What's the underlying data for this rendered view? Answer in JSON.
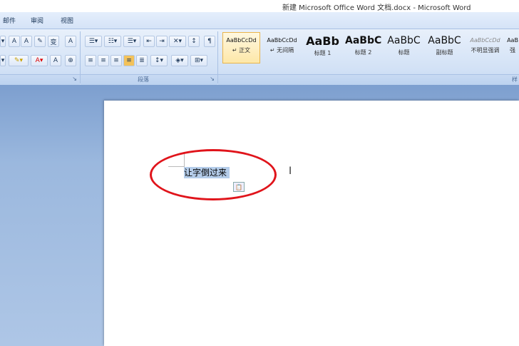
{
  "window": {
    "title": "新建 Microsoft Office Word 文档.docx - Microsoft Word"
  },
  "tabs": [
    "邮件",
    "审阅",
    "视图"
  ],
  "groups": {
    "paragraph": "段落",
    "styles_partial": "样"
  },
  "styles": [
    {
      "sample": "AaBbCcDd",
      "name": "↵ 正文",
      "selected": true
    },
    {
      "sample": "AaBbCcDd",
      "name": "↵ 无间隔"
    },
    {
      "sample": "AaBb",
      "name": "标题 1"
    },
    {
      "sample": "AaBbC",
      "name": "标题 2"
    },
    {
      "sample": "AaBbC",
      "name": "标题"
    },
    {
      "sample": "AaBbC",
      "name": "副标题"
    },
    {
      "sample": "AaBbCcDd",
      "name": "不明显强调"
    },
    {
      "sample": "AaB",
      "name": "强"
    }
  ],
  "document": {
    "selected_text": "让字倒过来"
  },
  "icons": {
    "ibeam": "I",
    "paste_options": "📋"
  },
  "colors": {
    "annotation_ellipse": "#e0141b",
    "selection": "#b5cdea"
  }
}
